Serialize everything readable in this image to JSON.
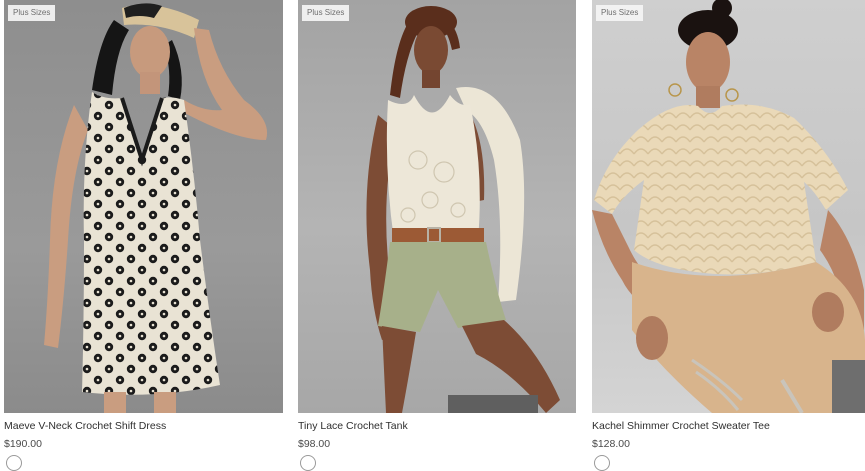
{
  "products": [
    {
      "badge": "Plus Sizes",
      "name": "Maeve V-Neck Crochet Shift Dress",
      "price": "$190.00",
      "image_alt": "Model wearing black and cream crochet shift dress with straw visor"
    },
    {
      "badge": "Plus Sizes",
      "name": "Tiny Lace Crochet Tank",
      "price": "$98.00",
      "image_alt": "Model wearing cream lace tank, sage shorts and brown belt"
    },
    {
      "badge": "Plus Sizes",
      "name": "Kachel Shimmer Crochet Sweater Tee",
      "price": "$128.00",
      "image_alt": "Model wearing cream crochet sweater tee with tan trousers"
    }
  ],
  "colors": {
    "badge_bg": "#f5f5f5",
    "text": "#2f2f2f",
    "price": "#4a4a4a"
  }
}
